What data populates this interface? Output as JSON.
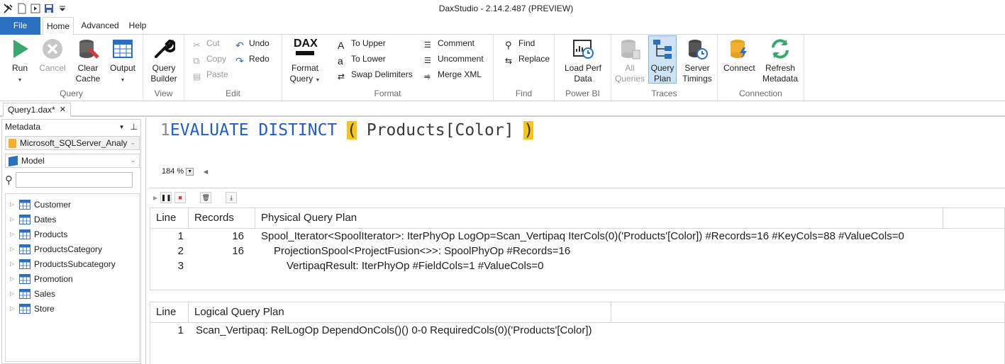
{
  "app": {
    "title": "DaxStudio - 2.14.2.487 (PREVIEW)"
  },
  "tabs": {
    "file": "File",
    "home": "Home",
    "advanced": "Advanced",
    "help": "Help"
  },
  "ribbon": {
    "query": {
      "label": "Query",
      "run": "Run",
      "cancel": "Cancel",
      "clear_cache_1": "Clear",
      "clear_cache_2": "Cache",
      "output": "Output"
    },
    "view": {
      "label": "View",
      "builder_1": "Query",
      "builder_2": "Builder"
    },
    "edit": {
      "label": "Edit",
      "cut": "Cut",
      "copy": "Copy",
      "paste": "Paste",
      "undo": "Undo",
      "redo": "Redo"
    },
    "format": {
      "label": "Format",
      "format_1": "Format",
      "format_2": "Query",
      "dax_logo": "DAX",
      "to_upper": "To Upper",
      "to_lower": "To Lower",
      "swap": "Swap Delimiters",
      "comment": "Comment",
      "uncomment": "Uncomment",
      "merge_xml": "Merge XML"
    },
    "find": {
      "label": "Find",
      "find": "Find",
      "replace": "Replace"
    },
    "powerbi": {
      "label": "Power BI",
      "load_1": "Load Perf",
      "load_2": "Data"
    },
    "traces": {
      "label": "Traces",
      "all_1": "All",
      "all_2": "Queries",
      "plan_1": "Query",
      "plan_2": "Plan",
      "timings_1": "Server",
      "timings_2": "Timings"
    },
    "connection": {
      "label": "Connection",
      "connect": "Connect",
      "refresh_1": "Refresh",
      "refresh_2": "Metadata"
    }
  },
  "document": {
    "tab_label": "Query1.dax*",
    "close": "✕"
  },
  "metadata": {
    "title": "Metadata",
    "pin": "⊥",
    "database": "Microsoft_SQLServer_Analy",
    "model": "Model",
    "search_placeholder": "",
    "tables": [
      "Customer",
      "Dates",
      "Products",
      "ProductsCategory",
      "ProductsSubcategory",
      "Promotion",
      "Sales",
      "Store"
    ]
  },
  "editor": {
    "line_number": "1",
    "kw1": "EVALUATE",
    "kw2": "DISTINCT",
    "open_paren": "(",
    "expr": "Products[Color]",
    "close_paren": ")",
    "zoom": "184 %"
  },
  "physical_plan": {
    "headers": {
      "line": "Line",
      "records": "Records",
      "plan": "Physical Query Plan"
    },
    "rows": [
      {
        "line": "1",
        "records": "16",
        "op": "Spool_Iterator<SpoolIterator>: IterPhyOp LogOp=Scan_Vertipaq IterCols(0)('Products'[Color]) #Records=16 #KeyCols=88 #ValueCols=0"
      },
      {
        "line": "2",
        "records": "16",
        "op": "ProjectionSpool<ProjectFusion<>>: SpoolPhyOp #Records=16"
      },
      {
        "line": "3",
        "records": "",
        "op": "VertipaqResult: IterPhyOp #FieldCols=1 #ValueCols=0"
      }
    ]
  },
  "logical_plan": {
    "headers": {
      "line": "Line",
      "plan": "Logical Query Plan"
    },
    "rows": [
      {
        "line": "1",
        "op": "Scan_Vertipaq: RelLogOp DependOnCols()() 0-0 RequiredCols(0)('Products'[Color])"
      }
    ]
  },
  "colors": {
    "accent": "#2b6fc0",
    "keyword": "#1f5ec9",
    "brace_highlight": "#f5c518"
  }
}
